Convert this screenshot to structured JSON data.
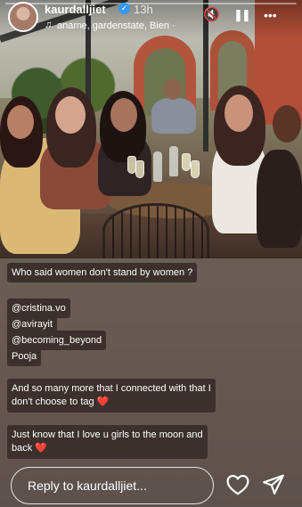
{
  "header": {
    "username": "kaurdalljiet",
    "time": "13h",
    "music": "aname, gardenstate, Bien ·",
    "verified_glyph": "✓",
    "mute_icon": "🔇",
    "pause_icon": "❚❚",
    "more_icon": "•••",
    "music_icon": "♫"
  },
  "progress": 0,
  "caption": {
    "question": "Who said women don't stand by women ?",
    "tags": [
      "@cristina.vo",
      "@avirayit",
      "@becoming_beyond",
      "Pooja"
    ],
    "more_line1": "And so many more that I connected with that I",
    "more_line2": "don't choose to tag",
    "love_line1": "Just know that I love u girls to the moon and",
    "love_line2": "back",
    "heart": "❤️"
  },
  "reply": {
    "placeholder": "Reply to kaurdalljiet..."
  },
  "icons": {
    "like": "heart-icon",
    "share": "send-icon"
  },
  "colors": {
    "bubble": "#3b302c",
    "verified": "#3897f0",
    "heart": "#e2263a"
  }
}
